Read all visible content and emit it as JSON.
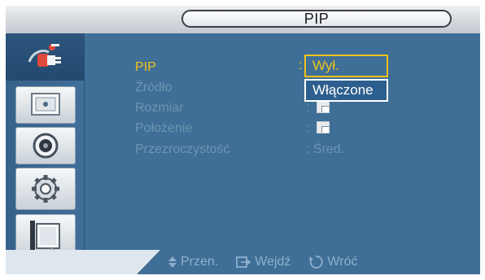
{
  "header": {
    "title": "PIP"
  },
  "sidebar": {
    "items": [
      {
        "icon": "input-plug-icon",
        "active": true
      },
      {
        "icon": "picture-icon",
        "active": false
      },
      {
        "icon": "sound-speaker-icon",
        "active": false
      },
      {
        "icon": "settings-gear-icon",
        "active": false
      },
      {
        "icon": "multi-screen-icon",
        "active": false
      }
    ]
  },
  "menu": {
    "options": [
      {
        "label": "PIP",
        "value": ": Wył."
      },
      {
        "label": "Źródło",
        "value": ":"
      },
      {
        "label": "Rozmiar",
        "value": ":"
      },
      {
        "label": "Położenie",
        "value": ":"
      },
      {
        "label": "Przezroczystość",
        "value": ": Śred."
      }
    ]
  },
  "dropdown": {
    "options": [
      "Wył.",
      "Włączone"
    ],
    "selected": "Wył."
  },
  "footer": {
    "move_label": "Przen.",
    "enter_label": "Wejdź",
    "return_label": "Wróć"
  },
  "colors": {
    "panel": "#3f6f96",
    "highlight": "#f2c21a",
    "inactive_text": "#6f93b2"
  }
}
